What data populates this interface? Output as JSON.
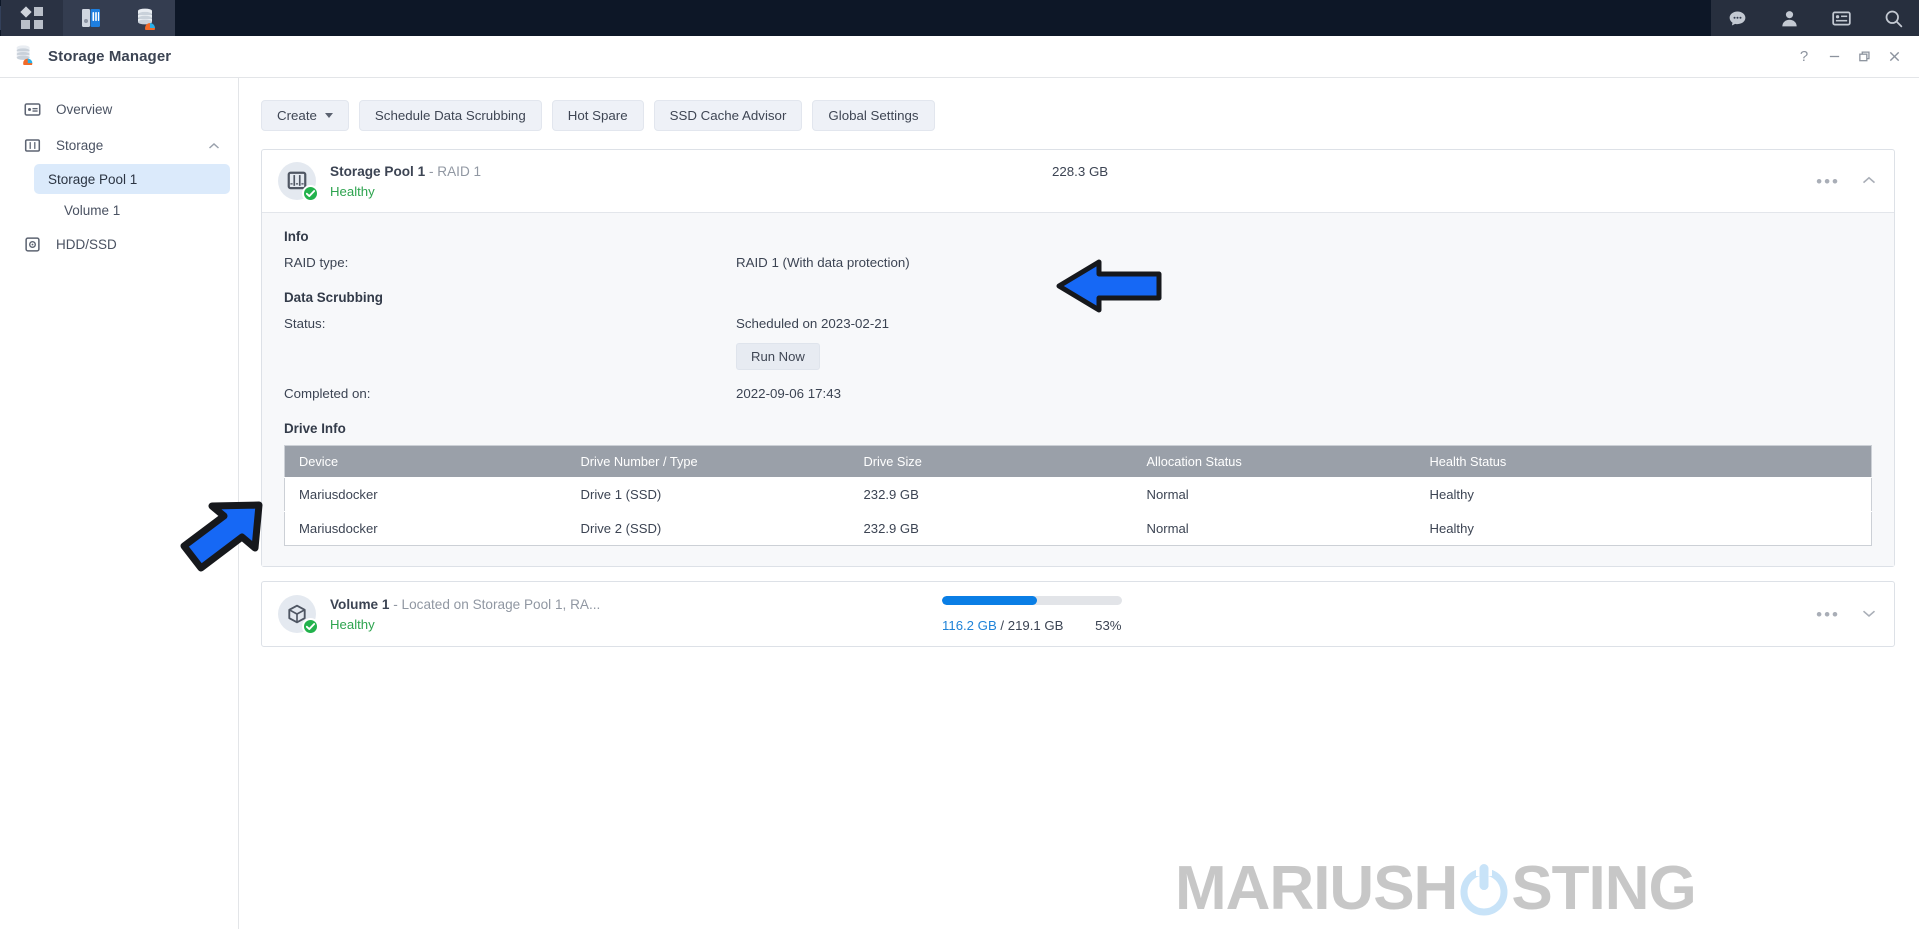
{
  "taskbar": {
    "icons": [
      {
        "name": "app-menu-icon",
        "label": "Main Menu"
      },
      {
        "name": "dsm-package-icon",
        "label": "DSM"
      },
      {
        "name": "storage-manager-taskbar-icon",
        "label": "Storage Manager"
      }
    ],
    "tray": [
      {
        "name": "notifications-icon",
        "label": "Notifications"
      },
      {
        "name": "user-account-icon",
        "label": "Account"
      },
      {
        "name": "widgets-icon",
        "label": "Widgets"
      },
      {
        "name": "search-icon",
        "label": "Search"
      }
    ]
  },
  "window": {
    "title": "Storage Manager",
    "controls": {
      "help": "?",
      "minimize": "—",
      "maximize": "❐",
      "close": "✕"
    }
  },
  "sidebar": {
    "items": [
      {
        "label": "Overview",
        "icon": "overview-icon",
        "selected": false
      },
      {
        "label": "Storage",
        "icon": "storage-icon",
        "selected": false,
        "expanded": true
      },
      {
        "label": "Storage Pool 1",
        "icon": "",
        "selected": true,
        "child": true
      },
      {
        "label": "Volume 1",
        "icon": "",
        "selected": false,
        "child": true,
        "deep": true
      },
      {
        "label": "HDD/SSD",
        "icon": "hdd-ssd-icon",
        "selected": false
      }
    ]
  },
  "toolbar": {
    "create_label": "Create",
    "schedule_label": "Schedule Data Scrubbing",
    "hot_spare_label": "Hot Spare",
    "ssd_cache_label": "SSD Cache Advisor",
    "global_settings_label": "Global Settings"
  },
  "pool": {
    "name": "Storage Pool 1",
    "separator": " - ",
    "raid": "RAID 1",
    "status": "Healthy",
    "size": "228.3 GB",
    "info_title": "Info",
    "raid_type_label": "RAID type:",
    "raid_type_value": "RAID 1 (With data protection)",
    "scrubbing_title": "Data Scrubbing",
    "status_label": "Status:",
    "status_value": "Scheduled on 2023-02-21",
    "run_now_label": "Run Now",
    "completed_label": "Completed on:",
    "completed_value": "2022-09-06 17:43",
    "drive_info_title": "Drive Info",
    "table": {
      "headers": [
        "Device",
        "Drive Number / Type",
        "Drive Size",
        "Allocation Status",
        "Health Status"
      ],
      "rows": [
        {
          "device": "Mariusdocker",
          "drive": "Drive 1 (SSD)",
          "size": "232.9 GB",
          "allocation": "Normal",
          "health": "Healthy"
        },
        {
          "device": "Mariusdocker",
          "drive": "Drive 2 (SSD)",
          "size": "232.9 GB",
          "allocation": "Normal",
          "health": "Healthy"
        }
      ]
    }
  },
  "volume": {
    "name": "Volume 1",
    "separator": " - ",
    "location": "Located on Storage Pool 1, RA...",
    "status": "Healthy",
    "used": "116.2 GB",
    "divider": "/ 219.1 GB",
    "percent_label": "53%",
    "percent_value": 53
  },
  "watermark": {
    "text_before": "MARIUSH",
    "text_after": "STING"
  },
  "colors": {
    "accent_blue": "#0a7ee5",
    "healthy_green": "#2ea44f",
    "annotation_blue": "#1668f5",
    "taskbar_dark": "#0d1727",
    "table_header_gray": "#9aa0a9",
    "selected_nav": "#dbeafb"
  }
}
